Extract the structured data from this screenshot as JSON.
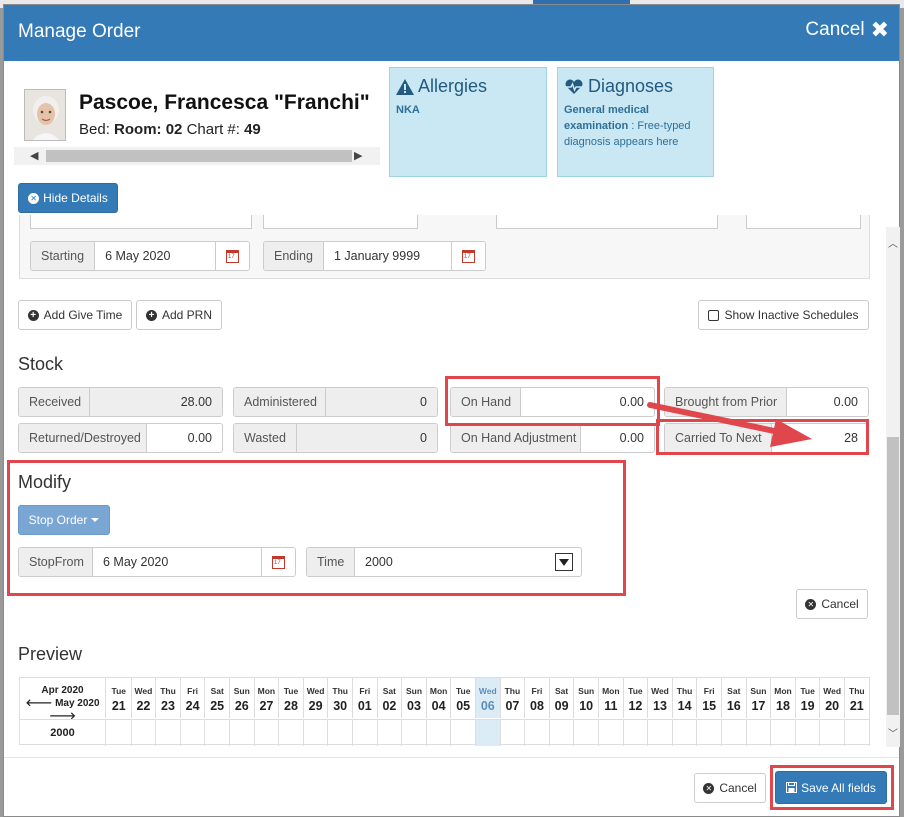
{
  "header": {
    "title": "Manage Order",
    "cancel_label": "Cancel"
  },
  "patient": {
    "name": "Pascoe, Francesca \"Franchi\"",
    "bed_label": "Bed:",
    "room_label": "Room:",
    "room": "02",
    "chart_label": "Chart #:",
    "chart": "49"
  },
  "allergies": {
    "title": "Allergies",
    "text": "NKA"
  },
  "diagnoses": {
    "title": "Diagnoses",
    "bold": "General medical examination",
    "rest": " : Free-typed diagnosis appears here"
  },
  "hide_details_label": "Hide Details",
  "schedule": {
    "starting_label": "Starting",
    "starting_value": "6 May 2020",
    "ending_label": "Ending",
    "ending_value": "1 January 9999",
    "add_give_time": "Add Give Time",
    "add_prn": "Add PRN",
    "show_inactive": "Show Inactive Schedules"
  },
  "stock": {
    "title": "Stock",
    "received_label": "Received",
    "received": "28.00",
    "administered_label": "Administered",
    "administered": "0",
    "on_hand_label": "On Hand",
    "on_hand": "0.00",
    "brought_label": "Brought from Prior",
    "brought": "0.00",
    "returned_label": "Returned/Destroyed",
    "returned": "0.00",
    "wasted_label": "Wasted",
    "wasted": "0",
    "adjustment_label": "On Hand Adjustment",
    "adjustment": "0.00",
    "carried_label": "Carried To Next",
    "carried": "28"
  },
  "modify": {
    "title": "Modify",
    "stop_order": "Stop Order",
    "stopfrom_label": "StopFrom",
    "stopfrom_value": "6 May 2020",
    "time_label": "Time",
    "time_value": "2000",
    "cancel_label": "Cancel"
  },
  "preview": {
    "title": "Preview",
    "month_top": "Apr 2020",
    "month_bottom": "May 2020",
    "row_label": "2000",
    "days": [
      {
        "dw": "Tue",
        "dn": "21"
      },
      {
        "dw": "Wed",
        "dn": "22"
      },
      {
        "dw": "Thu",
        "dn": "23"
      },
      {
        "dw": "Fri",
        "dn": "24"
      },
      {
        "dw": "Sat",
        "dn": "25"
      },
      {
        "dw": "Sun",
        "dn": "26"
      },
      {
        "dw": "Mon",
        "dn": "27"
      },
      {
        "dw": "Tue",
        "dn": "28"
      },
      {
        "dw": "Wed",
        "dn": "29"
      },
      {
        "dw": "Thu",
        "dn": "30"
      },
      {
        "dw": "Fri",
        "dn": "01"
      },
      {
        "dw": "Sat",
        "dn": "02"
      },
      {
        "dw": "Sun",
        "dn": "03"
      },
      {
        "dw": "Mon",
        "dn": "04"
      },
      {
        "dw": "Tue",
        "dn": "05"
      },
      {
        "dw": "Wed",
        "dn": "06"
      },
      {
        "dw": "Thu",
        "dn": "07"
      },
      {
        "dw": "Fri",
        "dn": "08"
      },
      {
        "dw": "Sat",
        "dn": "09"
      },
      {
        "dw": "Sun",
        "dn": "10"
      },
      {
        "dw": "Mon",
        "dn": "11"
      },
      {
        "dw": "Tue",
        "dn": "12"
      },
      {
        "dw": "Wed",
        "dn": "13"
      },
      {
        "dw": "Thu",
        "dn": "14"
      },
      {
        "dw": "Fri",
        "dn": "15"
      },
      {
        "dw": "Sat",
        "dn": "16"
      },
      {
        "dw": "Sun",
        "dn": "17"
      },
      {
        "dw": "Mon",
        "dn": "18"
      },
      {
        "dw": "Tue",
        "dn": "19"
      },
      {
        "dw": "Wed",
        "dn": "20"
      },
      {
        "dw": "Thu",
        "dn": "21"
      }
    ],
    "today_index": 15
  },
  "footer": {
    "cancel_label": "Cancel",
    "save_label": "Save All fields"
  },
  "colors": {
    "primary": "#337ab7",
    "highlight": "#e0474c",
    "info_bg": "#c9e8f3"
  }
}
